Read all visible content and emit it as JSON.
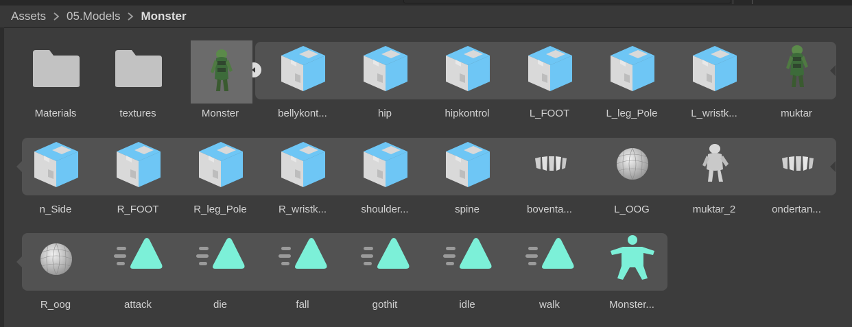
{
  "breadcrumb": [
    "Assets",
    "05.Models",
    "Monster"
  ],
  "colors": {
    "prefab_blue": "#6ec6f5",
    "prefab_gray": "#d9d9d9",
    "anim_teal": "#7cf0d8",
    "folder": "#c2c2c2",
    "group_bg": "#525252"
  },
  "rows": [
    [
      {
        "label": "Materials",
        "icon": "folder-icon"
      },
      {
        "label": "textures",
        "icon": "folder-icon"
      },
      {
        "label": "Monster",
        "icon": "model-thumbnail-icon"
      },
      {
        "label": "bellykont...",
        "icon": "prefab-icon"
      },
      {
        "label": "hip",
        "icon": "prefab-icon"
      },
      {
        "label": "hipkontrol",
        "icon": "prefab-icon"
      },
      {
        "label": "L_FOOT",
        "icon": "prefab-icon"
      },
      {
        "label": "L_leg_Pole",
        "icon": "prefab-icon"
      },
      {
        "label": "L_wristk...",
        "icon": "prefab-icon"
      },
      {
        "label": "muktar",
        "icon": "mesh-thumbnail-icon"
      }
    ],
    [
      {
        "label": "n_Side",
        "icon": "prefab-icon"
      },
      {
        "label": "R_FOOT",
        "icon": "prefab-icon"
      },
      {
        "label": "R_leg_Pole",
        "icon": "prefab-icon"
      },
      {
        "label": "R_wristk...",
        "icon": "prefab-icon"
      },
      {
        "label": "shoulder...",
        "icon": "prefab-icon"
      },
      {
        "label": "spine",
        "icon": "prefab-icon"
      },
      {
        "label": "boventa...",
        "icon": "teeth-mesh-icon"
      },
      {
        "label": "L_OOG",
        "icon": "sphere-mesh-icon"
      },
      {
        "label": "muktar_2",
        "icon": "body-mesh-icon"
      },
      {
        "label": "ondertan...",
        "icon": "teeth-mesh-icon"
      }
    ],
    [
      {
        "label": "R_oog",
        "icon": "sphere-mesh-icon"
      },
      {
        "label": "attack",
        "icon": "animation-clip-icon"
      },
      {
        "label": "die",
        "icon": "animation-clip-icon"
      },
      {
        "label": "fall",
        "icon": "animation-clip-icon"
      },
      {
        "label": "gothit",
        "icon": "animation-clip-icon"
      },
      {
        "label": "idle",
        "icon": "animation-clip-icon"
      },
      {
        "label": "walk",
        "icon": "animation-clip-icon"
      },
      {
        "label": "Monster...",
        "icon": "avatar-icon"
      }
    ]
  ]
}
